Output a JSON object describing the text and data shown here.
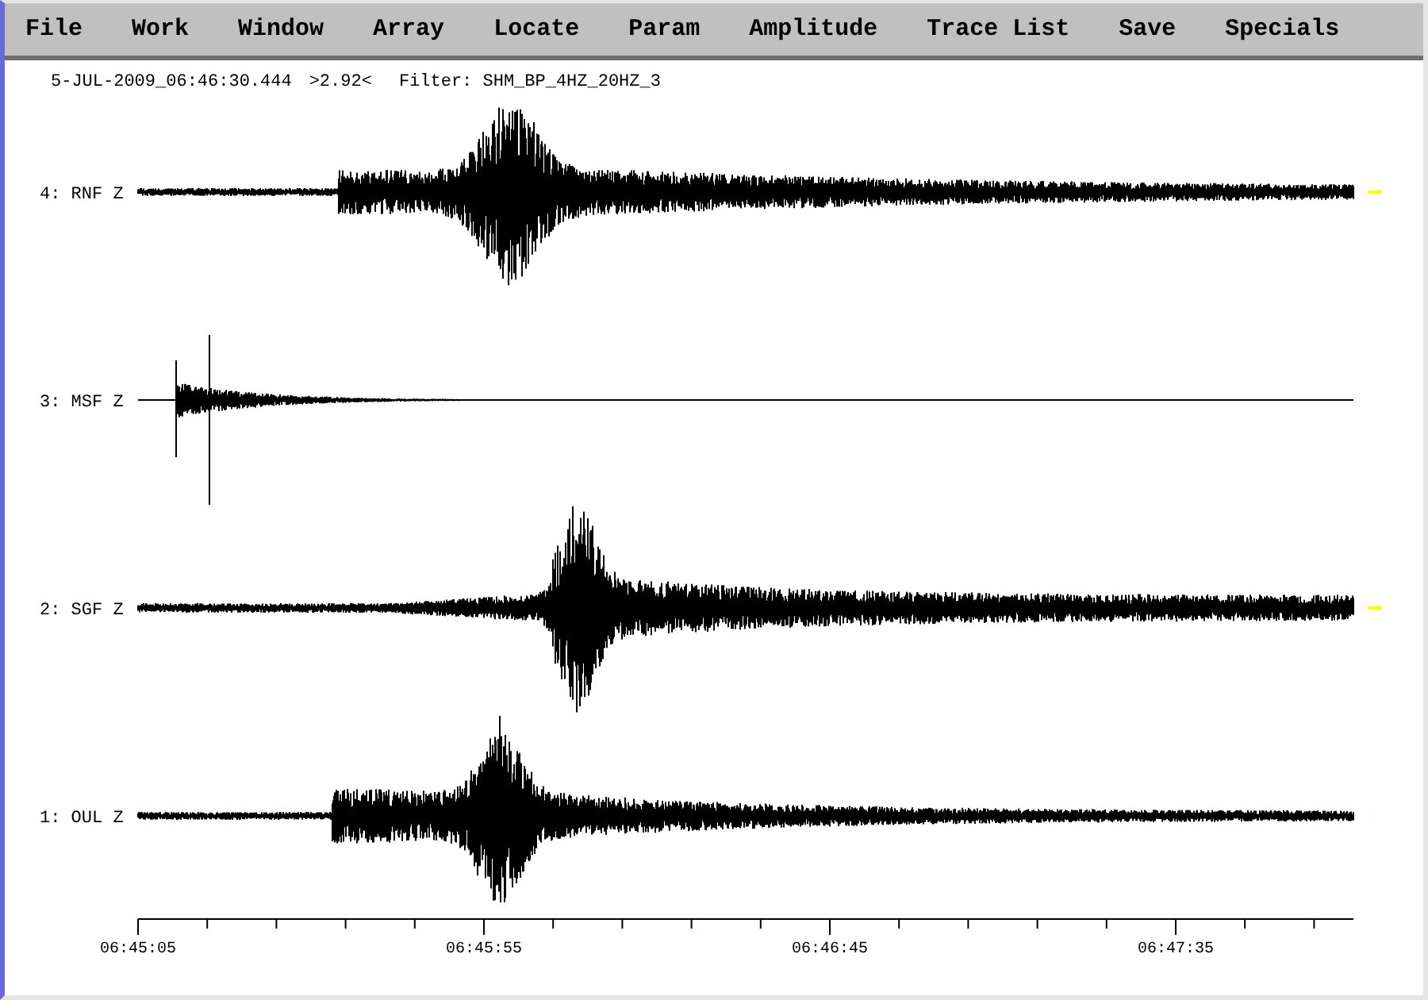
{
  "menu": [
    "File",
    "Work",
    "Window",
    "Array",
    "Locate",
    "Param",
    "Amplitude",
    "Trace List",
    "Save",
    "Specials"
  ],
  "info": {
    "time": "5-JUL-2009_06:46:30.444",
    "amplitude": ">2.92<",
    "filter": "Filter: SHM_BP_4HZ_20HZ_3"
  },
  "traces": [
    {
      "label": "4: RNF Z",
      "color": "#ffff00"
    },
    {
      "label": "3: MSF Z",
      "color": "#fffff0"
    },
    {
      "label": "2: SGF Z",
      "color": "#ffff00"
    },
    {
      "label": "1: OUL Z",
      "color": "#fffff0"
    }
  ],
  "time_axis": {
    "labels": [
      "06:45:05",
      "06:45:55",
      "06:46:45",
      "06:47:35"
    ]
  }
}
